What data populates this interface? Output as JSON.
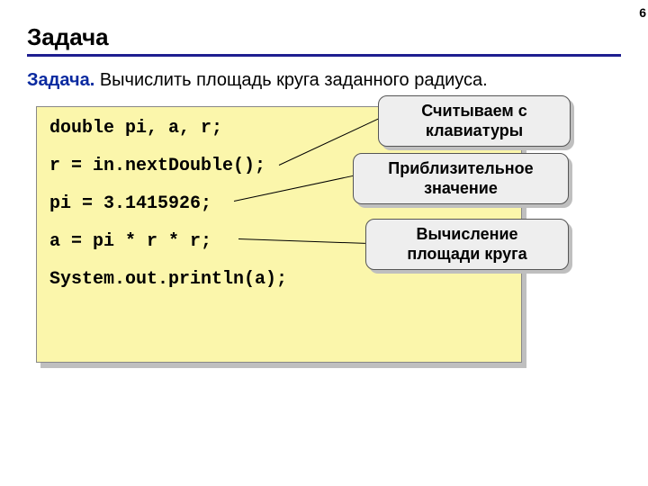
{
  "page_number": "6",
  "title": "Задача",
  "problem": {
    "label": "Задача.",
    "text": "  Вычислить площадь круга заданного радиуса."
  },
  "code": {
    "lines": [
      "double pi, a, r;",
      "r = in.nextDouble();",
      "pi = 3.1415926;",
      "a = pi * r * r;",
      "System.out.println(a);"
    ]
  },
  "callouts": {
    "c1": {
      "line1": "Считываем с",
      "line2": "клавиатуры"
    },
    "c2": {
      "line1": "Приблизительное",
      "line2": "значение"
    },
    "c3": {
      "line1": "Вычисление",
      "line2": "площади круга"
    }
  }
}
